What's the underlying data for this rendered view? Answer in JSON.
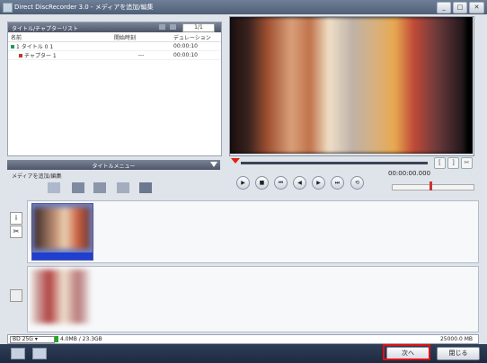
{
  "window": {
    "title": "Direct DiscRecorder 3.0 - メディアを追加/編集",
    "min_label": "_",
    "max_label": "□",
    "close_label": "✕"
  },
  "title_list": {
    "header": "タイトル/チャプターリスト",
    "page": "1/1",
    "columns": [
      "名前",
      "開始時刻",
      "デュレーション"
    ],
    "rows": [
      {
        "name": "1 タイトル 0 1",
        "start": "",
        "duration": "00:00:10",
        "marker": "#1f9a5a"
      },
      {
        "name": "チャプター 1",
        "start": "---",
        "duration": "00:00:10",
        "marker": "#c0392b"
      }
    ]
  },
  "title_menu": {
    "label": "タイトルメニュー",
    "edit_label": "メディアを追加/編集"
  },
  "preview": {
    "timecode": "00:00:00.000",
    "controls": [
      "▶",
      "■",
      "⏮",
      "◀",
      "▶",
      "⏭",
      "⟲"
    ]
  },
  "timeline": {
    "info_icon": "i",
    "scissors_icon": "✂"
  },
  "status": {
    "disc_type": "BD 25G",
    "capacity": "4.0MB / 23.3GB",
    "size": "25000.0 MB"
  },
  "buttons": {
    "next": "次へ",
    "close": "閉じる"
  },
  "colors": {
    "highlight": "#e01010",
    "accent": "#1f3fd0"
  }
}
